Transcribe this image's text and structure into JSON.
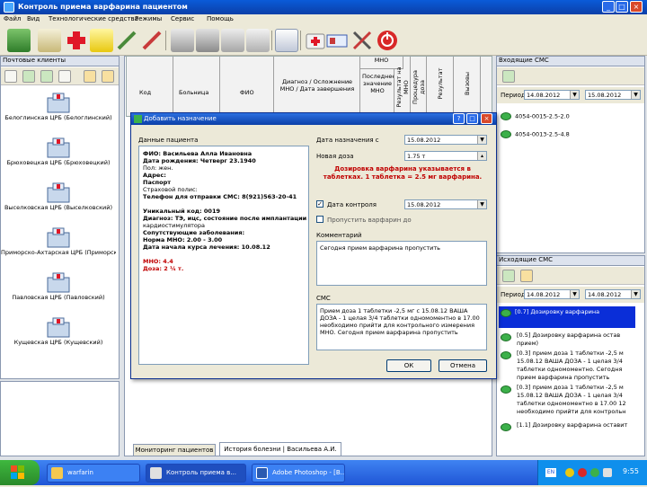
{
  "window": {
    "title": "Контроль приема варфарина пациентом"
  },
  "menu": [
    "Файл",
    "Вид",
    "Технологические средства",
    "Режимы",
    "Сервис",
    "Помощь"
  ],
  "left_panel": {
    "title": "Почтовые клиенты",
    "hospitals": [
      "Белоглинская ЦРБ (Белоглинский)",
      "Брюховецкая ЦРБ (Брюховецкий)",
      "Выселковская ЦРБ (Выселковский)",
      "Приморско-Ахтарская ЦРБ (Приморско-Ахтарский)",
      "Павловская ЦРБ (Павловский)",
      "Кущевская ЦРБ (Кущевский)"
    ]
  },
  "table": {
    "headers": [
      "Код",
      "Больница",
      "ФИО",
      "Диагноз / Осложнение МНО / Дата завершения",
      "Последнее значение МНО",
      "Результат на МНО",
      "Процедура доза",
      "Результат",
      "Вызовы",
      "МНО"
    ]
  },
  "dialog": {
    "title": "Добавить назначение",
    "patient_section_label": "Данные пациента",
    "patient": {
      "fio": "ФИО: Васильева Алла Ивановна",
      "dob": "Дата рождения: Четверг 23.1940",
      "sex": "Пол: жен.",
      "address": "Адрес:",
      "passport": "Паспорт",
      "insurance": "Страховой полис:",
      "phone": "Телефон для отправки СМС: 8(921)563-20-41",
      "unique": "Уникальный код: 0019",
      "diagnosis": "Диагноз: ТЭ, ицс, состояние после имплантации",
      "diagnosis2": "кардиостимулятора",
      "comorbid": "Сопутствующие заболевания:",
      "norm": "Норма МНО: 2.00 - 3.00",
      "start": "Дата начала курса лечения: 10.08.12",
      "mno": "МНО: 4.4",
      "dose": "Доза: 2 ¼ т."
    },
    "date_start_label": "Дата назначения с",
    "date_start": "15.08.2012",
    "new_dose_label": "Новая доза",
    "new_dose": "1.75 т",
    "warning": "Дозировка варфарина указывается в таблетках. 1 таблетка = 2.5 мг варфарина.",
    "control_date_label": "Дата контроля",
    "control_date": "15.08.2012",
    "skip_label": "Пропустить варфарин до",
    "comment_label": "Комментарий",
    "comment": "Сегодня прием варфарина пропустить",
    "sms_label": "СМС",
    "sms_lines": [
      "Прием доза 1 таблетки -2,5 мг с 15.08.12 ВАША",
      "ДОЗА - 1 целая 3/4 таблетки одномоментно в 17.00",
      "необходимо прийти для контрольного измерения",
      "МНО. Сегодня прием варфарина пропустить"
    ],
    "ok": "ОК",
    "cancel": "Отмена"
  },
  "right_top": {
    "title": "Входящие СМС",
    "period_label": "Период",
    "period_from": "14.08.2012",
    "period_to": "15.08.2012",
    "items": [
      "4054-0015-2.5-2.0",
      "4054-0013-2.5-4.8"
    ]
  },
  "right_bottom": {
    "title": "Исходящие СМС",
    "period_label": "Период",
    "period_from": "14.08.2012",
    "period_to": "14.08.2012",
    "items": [
      "[0.7] Дозировку варфарина",
      "[0.5] Дозировку варфарина остав",
      "прием)",
      "[0.3] прием доза 1 таблетки -2,5 м",
      "15.08.12 ВАША ДОЗА - 1 целая 3/4",
      "таблетки одномоментно. Сегодня",
      "прием варфарина пропустить",
      "[0.3] прием доза 1 таблетки -2,5 м",
      "15.08.12 ВАША ДОЗА - 1 целая 3/4",
      "таблетки одномоментно в 17.00 12",
      "необходимо прийти для контрольн",
      "[1.1] Дозировку варфарина оставит"
    ]
  },
  "bottom_tabs": [
    "Мониторинг пациентов",
    "История болезни | Васильева А.И."
  ],
  "taskbar": {
    "tasks": [
      "warfarin",
      "Контроль приема в...",
      "Adobe Photoshop - [B..."
    ],
    "clock": "9:55"
  },
  "colors": {
    "accent": "#0b3fa8",
    "warning": "#c00000",
    "sms_green": "#3cb04a"
  }
}
